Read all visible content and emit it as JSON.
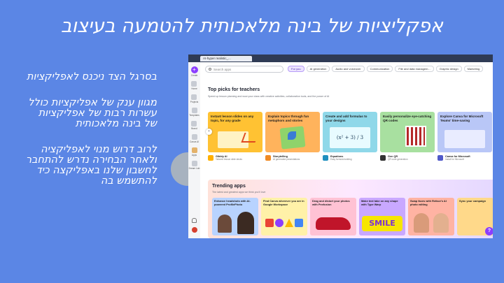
{
  "slide": {
    "title": "אפקליציות של בינה מלאכותית להטמעה בעיצוב",
    "paragraphs": [
      "בסרגל הצד ניכנס לאפליקציות",
      "מגוון ענק של אפליקציות כולל עשרות רבות של אפליקציות של בינה מלאכותית",
      "לרוב דרוש מנוי לאפליקציה ולאחר הבחירה נדרש להתחבר לחשבון שלנו באפליקצה כיד להתשמש בה"
    ]
  },
  "browser": {
    "tab_label": "AI-hyper realistic_..."
  },
  "rail": {
    "items": [
      {
        "label": "Create",
        "icon": "plus-icon"
      },
      {
        "label": "Home",
        "icon": "home-icon"
      },
      {
        "label": "Projects",
        "icon": "folder-icon"
      },
      {
        "label": "Templates",
        "icon": "templates-icon"
      },
      {
        "label": "Brand",
        "icon": "brand-icon"
      },
      {
        "label": "Canva AI",
        "icon": "sparkle-icon"
      },
      {
        "label": "Apps",
        "icon": "apps-icon"
      },
      {
        "label": "Dream Lab",
        "icon": "dream-lab-icon"
      }
    ]
  },
  "search": {
    "placeholder": "Search apps"
  },
  "chips": [
    "For you",
    "AI generation",
    "Audio and voiceover",
    "Communication",
    "File and data managem...",
    "Graphic design",
    "Marketing"
  ],
  "top_picks": {
    "title": "Top picks for teachers",
    "subtitle": "Speed up lesson planning and wow your class with creative activities, collaboration tools, and the power of AI",
    "cards": [
      {
        "title": "Instant lesson slides on any topic, for any grade",
        "name": "Gibbly AI",
        "desc": "Tailored lesson slide decks",
        "bg": "#ffc233"
      },
      {
        "title": "Explain topics through fun metaphors and stories",
        "name": "Storytelling",
        "desc": "AI generated presentations",
        "bg": "#ffb35c"
      },
      {
        "title": "Create and add formulas to your designs",
        "name": "Equations",
        "desc": "Easy formula building",
        "bg": "#8fd8e9",
        "formula": "(x² + 3) / 3"
      },
      {
        "title": "Easily personalize eye-catching QR codes",
        "name": "Gen QR",
        "desc": "QR code generation",
        "bg": "#a8e0a0"
      },
      {
        "title": "Explore Canva for Microsoft Teams' time-saving",
        "name": "Canva for Microsoft",
        "desc": "Install for Microsoft",
        "bg": "#b9c7f7"
      }
    ]
  },
  "trending": {
    "title": "Trending apps",
    "subtitle": "The latest and greatest apps we think you'll love",
    "cards": [
      {
        "title": "Enhance headshots with AI-powered ProfilePhoto",
        "bg": "#b8d3ff"
      },
      {
        "title": "Find Canva wherever you are in Google Workspace",
        "bg": "#fff1a8"
      },
      {
        "title": "Drag and distort your photos with Pexfusion",
        "bg": "#ffc2d4"
      },
      {
        "title": "Make text take on any shape with Type Warp",
        "bg": "#c9a8ff",
        "word": "SMILE"
      },
      {
        "title": "Swap faces with Reface's AI photo editing",
        "bg": "#ffb3a3"
      },
      {
        "title": "Sync your campaign",
        "bg": "#ffd98a"
      }
    ],
    "help_label": "?"
  },
  "colors": {
    "background": "#5b86e5",
    "canva_purple": "#8b3dff"
  }
}
